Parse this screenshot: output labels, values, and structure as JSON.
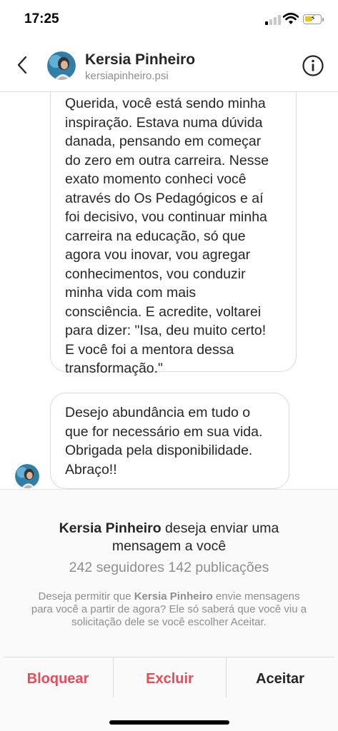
{
  "status_bar": {
    "time": "17:25"
  },
  "header": {
    "name": "Kersia Pinheiro",
    "handle": "kersiapinheiro.psi",
    "avatar_icon": "profile-avatar",
    "back_icon": "chevron-left-icon",
    "info_icon": "info-icon"
  },
  "messages": [
    {
      "text": "Querida, você está sendo minha\ninspiração. Estava numa dúvida\ndanada, pensando em começar\ndo zero em outra carreira. Nesse\nexato momento conheci você\natravés do Os Pedagógicos e aí\nfoi decisivo, vou continuar minha\ncarreira na educação, só que\nagora vou inovar, vou agregar\nconhecimentos, vou conduzir\nminha vida com mais\nconsciência. E acredite, voltarei\npara dizer: \"Isa, deu muito certo!\nE você foi a mentora dessa\ntransformação.\""
    },
    {
      "text": "Desejo abundância em tudo o\nque for necessário em sua vida.\nObrigada pela disponibilidade.\nAbraço!!"
    }
  ],
  "request": {
    "title_name": "Kersia Pinheiro",
    "title_rest": " deseja enviar uma",
    "title_line2": "mensagem a você",
    "stats": "242 seguidores 142 publicações",
    "desc_prefix": "Deseja permitir que ",
    "desc_name": "Kersia Pinheiro",
    "desc_suffix": " envie mensagens para você a partir de agora? Ele só saberá que você viu a solicitação dele se você escolher Aceitar."
  },
  "actions": {
    "block_label": "Bloquear",
    "delete_label": "Excluir",
    "accept_label": "Aceitar"
  },
  "colors": {
    "danger": "#ed4956",
    "text": "#262626",
    "muted": "#8e8e8e",
    "border": "#dbdbdb"
  }
}
